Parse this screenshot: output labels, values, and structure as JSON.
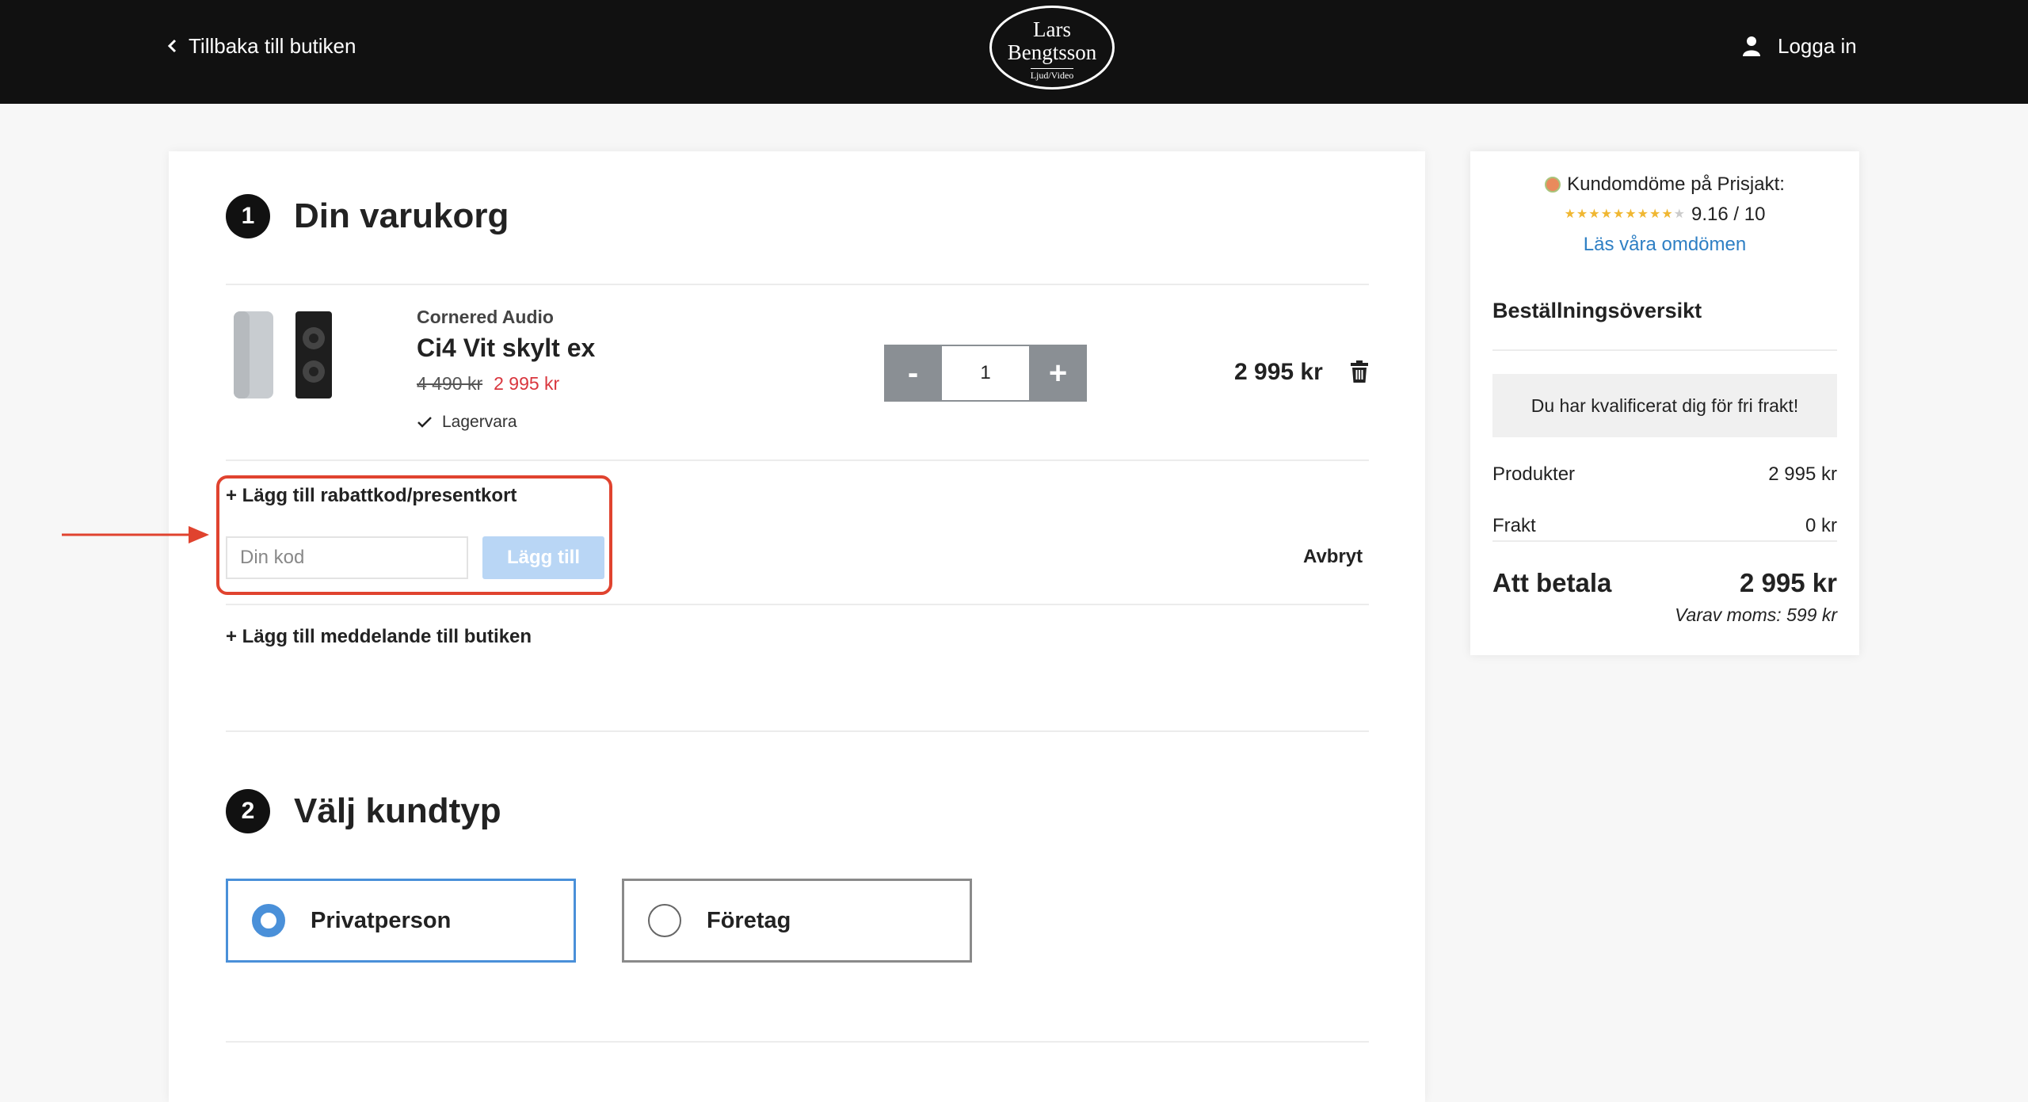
{
  "header": {
    "back_label": "Tillbaka till butiken",
    "logo_line1": "Lars",
    "logo_line2": "Bengtsson",
    "logo_line3": "Ljud/Video",
    "login_label": "Logga in"
  },
  "cart": {
    "step_number": "1",
    "title": "Din varukorg",
    "item": {
      "brand": "Cornered Audio",
      "name": "Ci4 Vit skylt ex",
      "old_price": "4 490 kr",
      "price": "2 995 kr",
      "stock": "Lagervara",
      "quantity": "1",
      "minus_label": "-",
      "plus_label": "+",
      "line_total": "2 995 kr"
    },
    "coupon_toggle": "+ Lägg till rabattkod/presentkort",
    "coupon_placeholder": "Din kod",
    "coupon_button": "Lägg till",
    "cancel_label": "Avbryt",
    "message_toggle": "+ Lägg till meddelande till butiken"
  },
  "customer_type": {
    "step_number": "2",
    "title": "Välj kundtyp",
    "options": [
      {
        "label": "Privatperson",
        "selected": true
      },
      {
        "label": "Företag",
        "selected": false
      }
    ]
  },
  "sidebar": {
    "rating_label": "Kundomdöme på Prisjakt:",
    "rating_score": "9.16 / 10",
    "rating_value": 9.16,
    "reviews_link": "Läs våra omdömen",
    "summary_title": "Beställningsöversikt",
    "free_shipping": "Du har kvalificerat dig för fri frakt!",
    "products_label": "Produkter",
    "products_value": "2 995 kr",
    "shipping_label": "Frakt",
    "shipping_value": "0 kr",
    "total_label": "Att betala",
    "total_value": "2 995 kr",
    "vat_note": "Varav moms: 599 kr"
  },
  "colors": {
    "header_bg": "#111111",
    "sale_price": "#d9363e",
    "accent_blue": "#4a90d9",
    "link_blue": "#2e7fc4",
    "annotation_red": "#e0432f",
    "qty_button": "#8a8f94",
    "coupon_button_bg": "#b9d6f5"
  }
}
